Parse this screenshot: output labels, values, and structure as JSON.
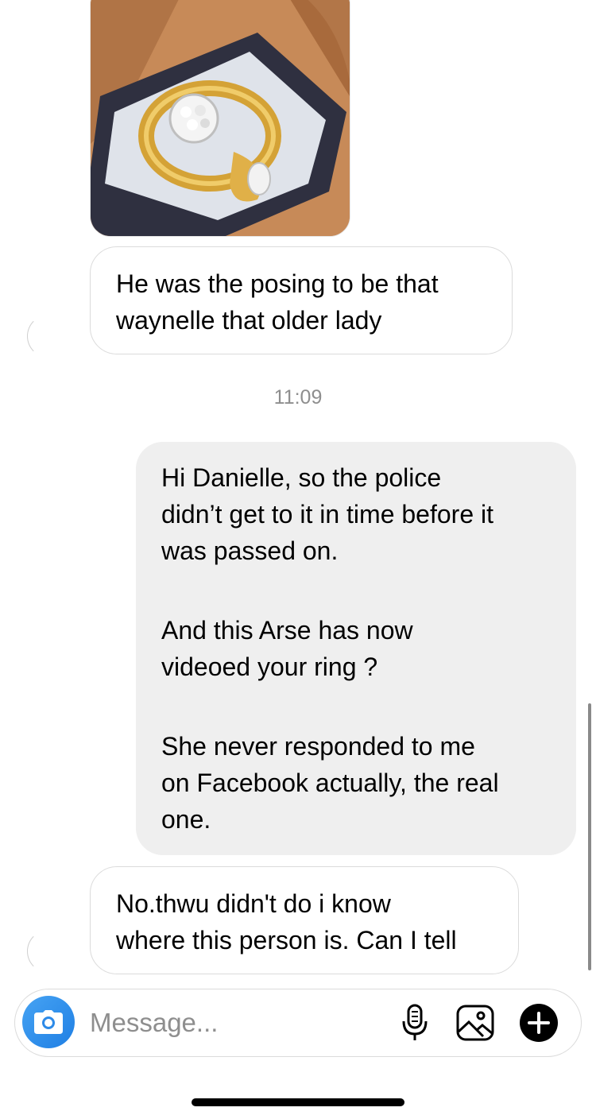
{
  "thread": {
    "messages": [
      {
        "direction": "incoming",
        "type": "photo",
        "icon": "ring-photo"
      },
      {
        "direction": "incoming",
        "text": "He was the posing to be that\nwaynelle that older lady"
      },
      {
        "timestamp": "11:09"
      },
      {
        "direction": "outgoing",
        "paragraphs": [
          "Hi Danielle, so the police\ndidn’t get to it in time before it\nwas passed on.",
          "And this Arse has now\nvideoed your ring ?",
          "She never responded to me\non Facebook actually, the real\none."
        ]
      },
      {
        "direction": "incoming",
        "text": "No.thwu didn't do i know\nwhere this person is. Can I tell"
      }
    ]
  },
  "composer": {
    "placeholder": "Message...",
    "value": "",
    "camera_icon": "camera-icon",
    "mic_icon": "microphone-icon",
    "gallery_icon": "gallery-icon",
    "add_icon": "plus-icon",
    "accent": "#3897f0"
  }
}
